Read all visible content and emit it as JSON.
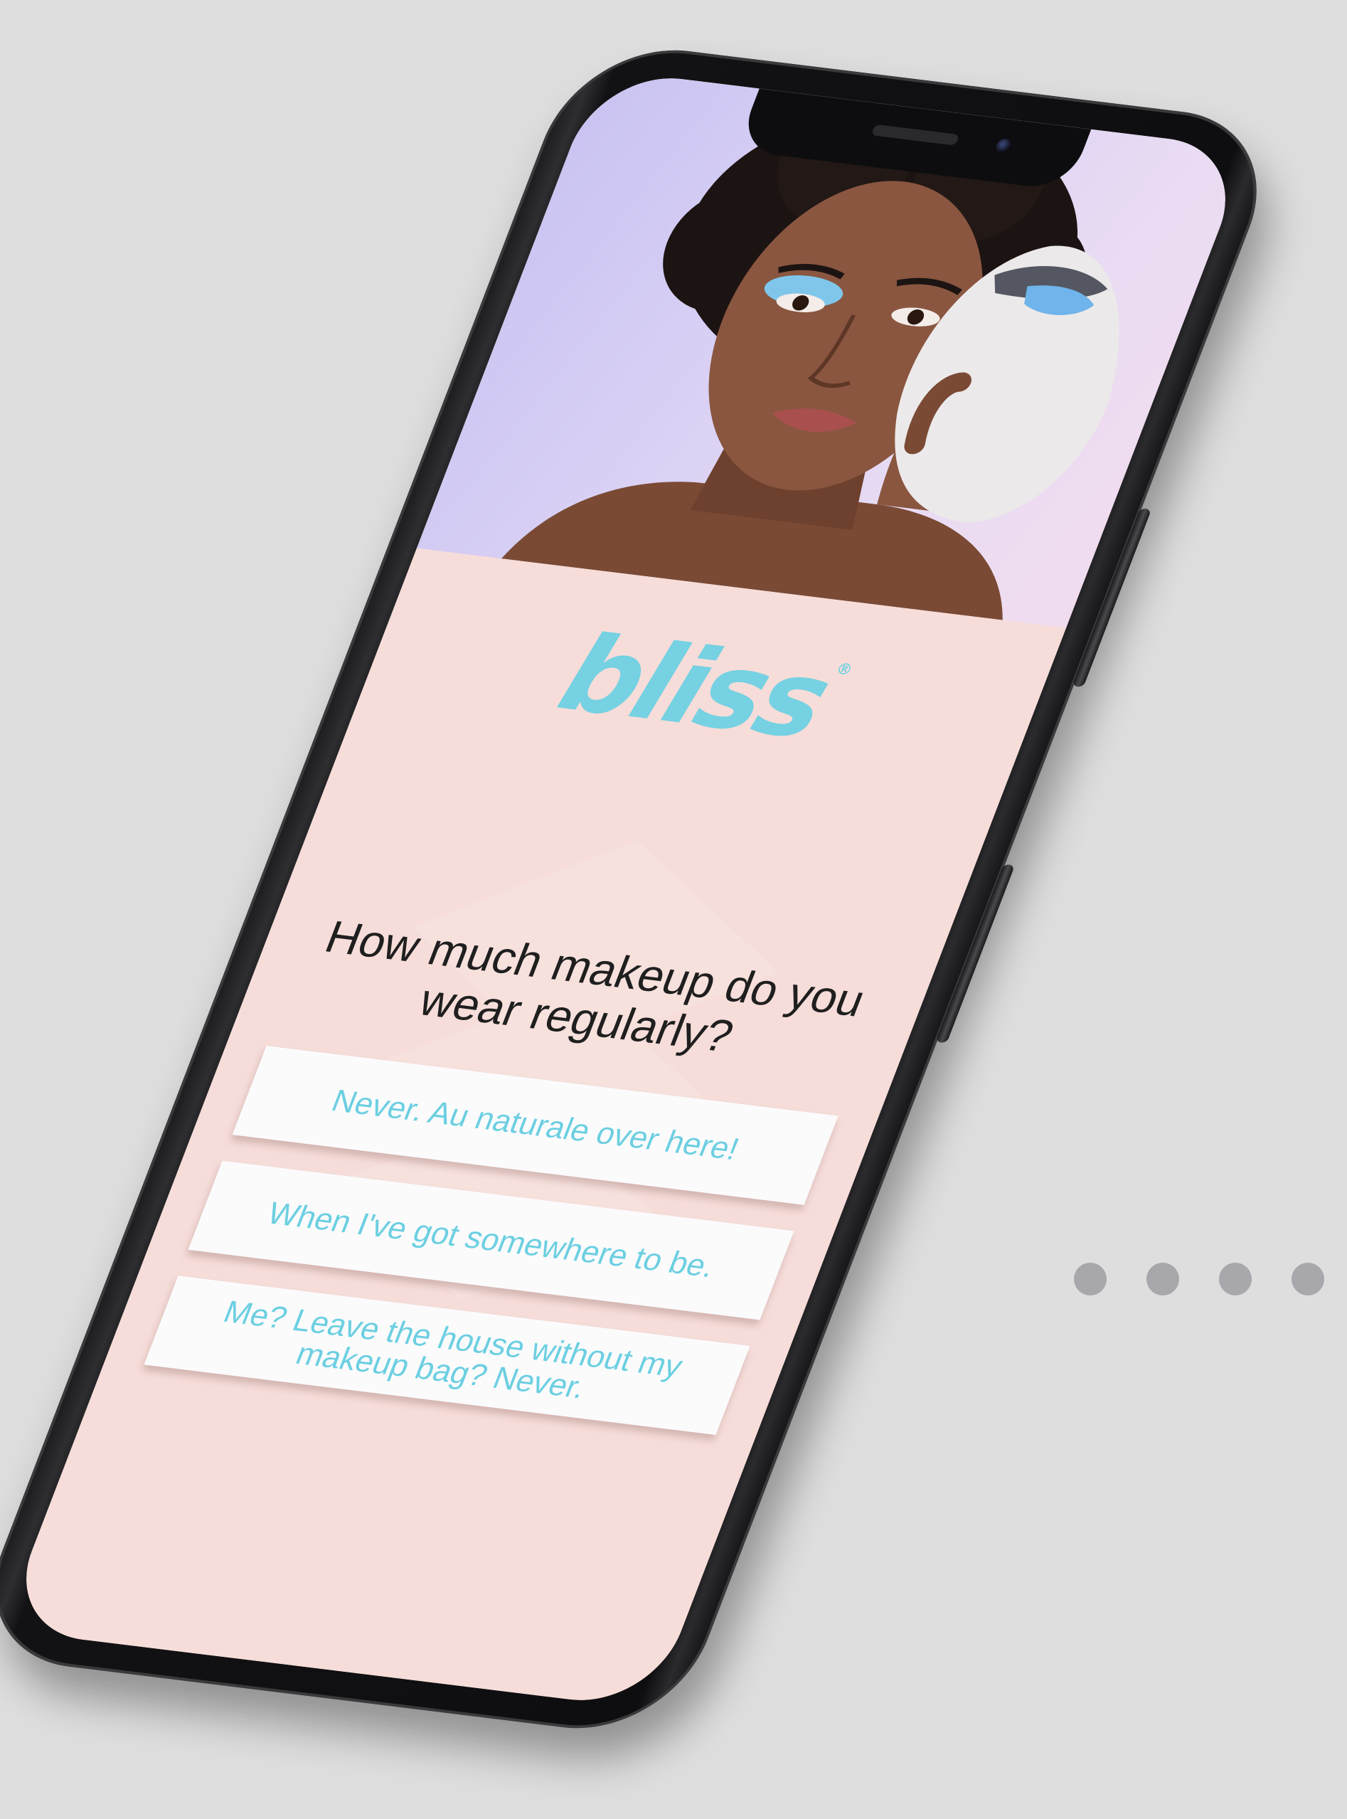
{
  "brand": {
    "logo_text": "bliss",
    "registered_mark": "®",
    "color": "#76d1e2"
  },
  "quiz": {
    "question": "How much makeup do you wear regularly?",
    "answers": [
      {
        "label": "Never. Au naturale over here!"
      },
      {
        "label": "When I've got somewhere to be."
      },
      {
        "label": "Me? Leave the house without my makeup bag? Never."
      }
    ]
  },
  "pagination": {
    "count": 4
  },
  "colors": {
    "page_background": "#dedede",
    "screen_background": "#f6ddd9",
    "answer_text": "#6ccfe1",
    "question_text": "#1f1f1f",
    "dot": "#a8a8ac"
  }
}
